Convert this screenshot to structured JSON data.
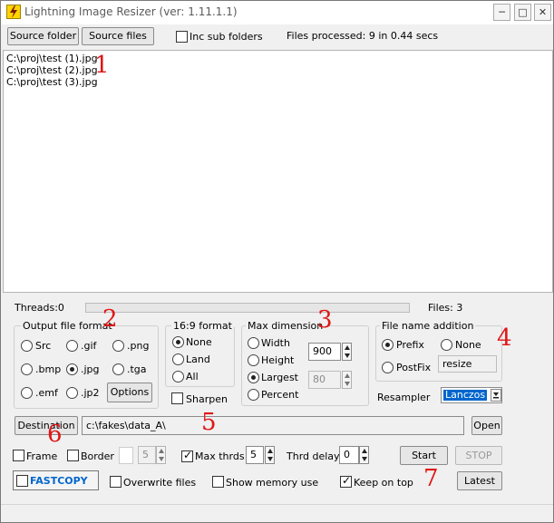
{
  "window": {
    "title": "Lightning Image Resizer (ver: 1.11.1.1)",
    "controls": {
      "minimize": "─",
      "maximize": "□",
      "close": "✕"
    }
  },
  "toolbar": {
    "source_folder": "Source folder",
    "source_files": "Source files",
    "inc_sub_folders": "Inc sub folders",
    "files_processed": "Files processed: 9 in 0.44 secs"
  },
  "file_list": [
    "C:\\proj\\test (1).jpg",
    "C:\\proj\\test (2).jpg",
    "C:\\proj\\test (3).jpg"
  ],
  "status": {
    "threads": "Threads:0",
    "files": "Files: 3"
  },
  "output_format": {
    "title": "Output file format",
    "options": [
      "Src",
      ".gif",
      ".png",
      ".bmp",
      ".jpg",
      ".tga",
      ".emf",
      ".jp2"
    ],
    "selected": ".jpg",
    "options_button": "Options"
  },
  "aspect": {
    "title": "16:9 format",
    "options": [
      "None",
      "Land",
      "All"
    ],
    "selected": "None",
    "sharpen": "Sharpen"
  },
  "max_dimension": {
    "title": "Max dimension",
    "options": [
      "Width",
      "Height",
      "Largest",
      "Percent"
    ],
    "selected": "Largest",
    "size_value": "900",
    "percent_value": "80"
  },
  "file_name_addition": {
    "title": "File name addition",
    "prefix": "Prefix",
    "none": "None",
    "postfix": "PostFix",
    "selected": "Prefix",
    "text_value": "resize"
  },
  "resampler": {
    "label": "Resampler",
    "value": "Lanczos"
  },
  "destination": {
    "button": "Destination",
    "path": "c:\\fakes\\data_A\\",
    "open_button": "Open"
  },
  "bottom": {
    "frame": "Frame",
    "border": "Border",
    "border_value": "5",
    "max_thrds": "Max thrds",
    "max_thrds_value": "5",
    "thrd_delay": "Thrd delay",
    "thrd_delay_value": "0",
    "start": "Start",
    "stop": "STOP",
    "fastcopy": "FASTCOPY",
    "overwrite": "Overwrite files",
    "show_memory": "Show memory use",
    "keep_on_top": "Keep on top",
    "latest": "Latest"
  },
  "annotations": [
    "1",
    "2",
    "3",
    "4",
    "5",
    "6",
    "7"
  ],
  "colors": {
    "accent_blue": "#0066cc",
    "annotation_red": "#e01616",
    "icon_yellow": "#ffd400"
  }
}
